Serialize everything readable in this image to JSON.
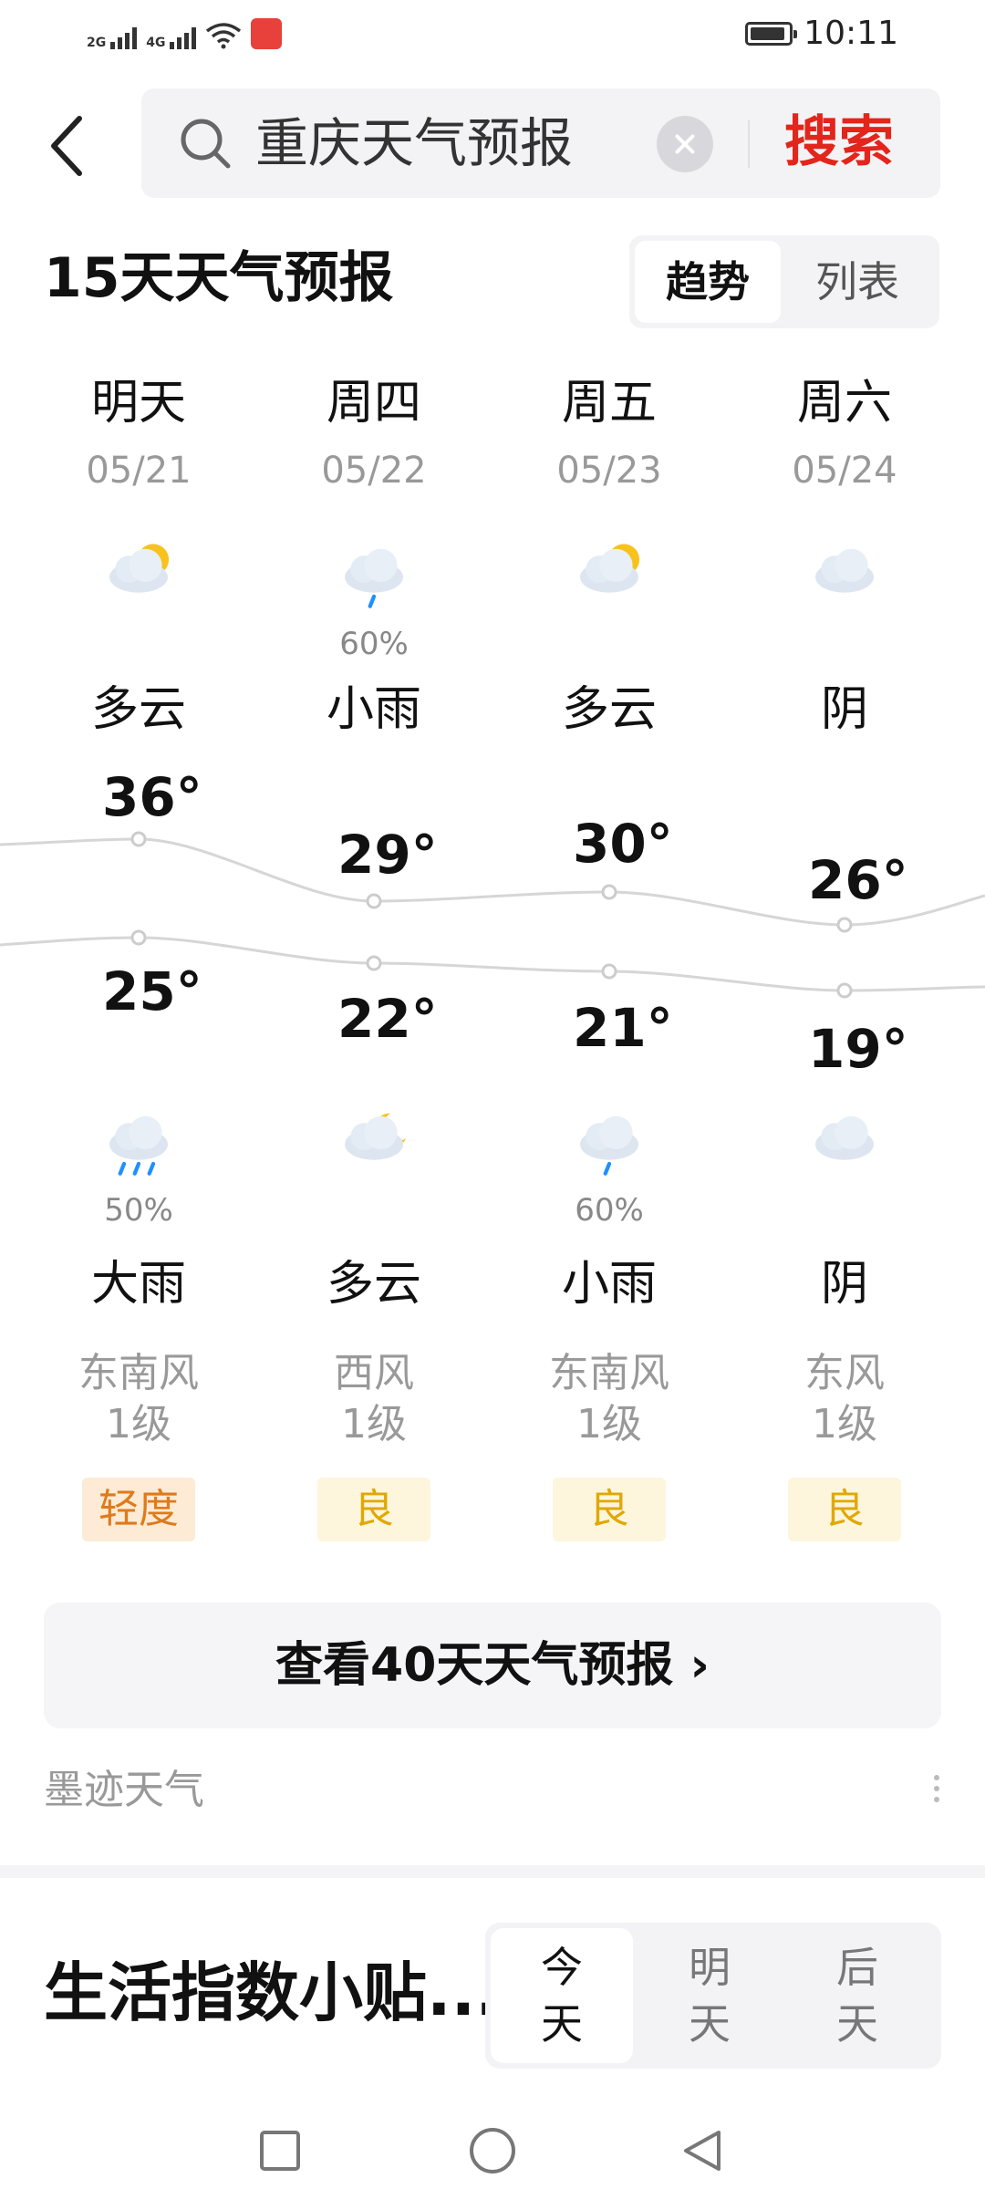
{
  "status": {
    "network1": "2G",
    "network2": "4G",
    "time": "10:11"
  },
  "search": {
    "query": "重庆天气预报",
    "button": "搜索"
  },
  "forecast": {
    "title": "15天天气预报",
    "toggle": [
      "趋势",
      "列表"
    ],
    "days": [
      {
        "name": "明天",
        "date": "05/21",
        "day_icon": "partly-cloudy-icon",
        "day_precip": "",
        "day_weather": "多云",
        "high": "36°",
        "low": "25°",
        "night_icon": "heavy-rain-icon",
        "night_precip": "50%",
        "night_weather": "大雨",
        "wind_dir": "东南风",
        "wind_level": "1级",
        "aqi": "轻度"
      },
      {
        "name": "周四",
        "date": "05/22",
        "day_icon": "light-rain-icon",
        "day_precip": "60%",
        "day_weather": "小雨",
        "high": "29°",
        "low": "22°",
        "night_icon": "cloudy-night-icon",
        "night_precip": "",
        "night_weather": "多云",
        "wind_dir": "西风",
        "wind_level": "1级",
        "aqi": "良"
      },
      {
        "name": "周五",
        "date": "05/23",
        "day_icon": "partly-cloudy-icon",
        "day_precip": "",
        "day_weather": "多云",
        "high": "30°",
        "low": "21°",
        "night_icon": "light-rain-icon",
        "night_precip": "60%",
        "night_weather": "小雨",
        "wind_dir": "东南风",
        "wind_level": "1级",
        "aqi": "良"
      },
      {
        "name": "周六",
        "date": "05/24",
        "day_icon": "overcast-icon",
        "day_precip": "",
        "day_weather": "阴",
        "high": "26°",
        "low": "19°",
        "night_icon": "overcast-icon",
        "night_precip": "",
        "night_weather": "阴",
        "wind_dir": "东风",
        "wind_level": "1级",
        "aqi": "良"
      }
    ],
    "more": "查看40天天气预报 ›",
    "source": "墨迹天气"
  },
  "life": {
    "title": "生活指数小贴...",
    "tabs": [
      {
        "top": "今",
        "bottom": "天"
      },
      {
        "top": "明",
        "bottom": "天"
      },
      {
        "top": "后",
        "bottom": "天"
      }
    ]
  },
  "colors": {
    "search_button": "#e3251c",
    "aqi_light": "#fdebd6",
    "aqi_light_text": "#e07a1a",
    "aqi_good": "#fdf6dc",
    "aqi_good_text": "#e0a800"
  }
}
